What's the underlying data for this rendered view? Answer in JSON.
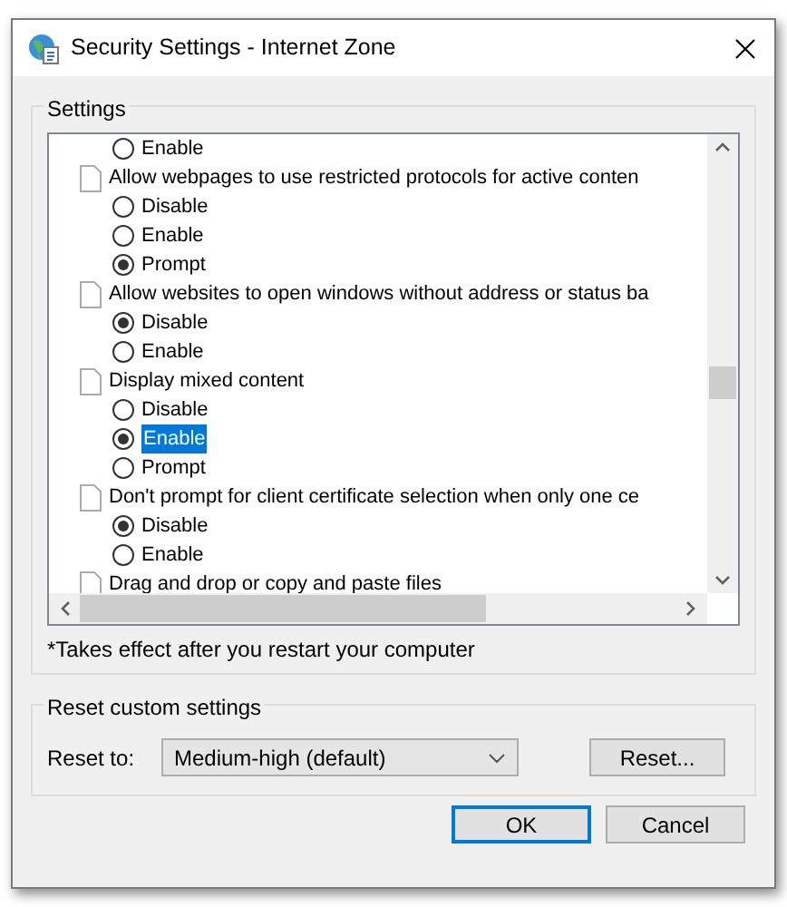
{
  "window": {
    "title": "Security Settings - Internet Zone"
  },
  "settings": {
    "title": "Settings",
    "items": [
      {
        "kind": "option",
        "label": "Enable",
        "selected": false,
        "highlighted": false
      },
      {
        "kind": "setting",
        "label": "Allow webpages to use restricted protocols for active conten",
        "children": [
          {
            "kind": "option",
            "label": "Disable",
            "selected": false,
            "highlighted": false
          },
          {
            "kind": "option",
            "label": "Enable",
            "selected": false,
            "highlighted": false
          },
          {
            "kind": "option",
            "label": "Prompt",
            "selected": true,
            "highlighted": false
          }
        ]
      },
      {
        "kind": "setting",
        "label": "Allow websites to open windows without address or status ba",
        "children": [
          {
            "kind": "option",
            "label": "Disable",
            "selected": true,
            "highlighted": false
          },
          {
            "kind": "option",
            "label": "Enable",
            "selected": false,
            "highlighted": false
          }
        ]
      },
      {
        "kind": "setting",
        "label": "Display mixed content",
        "children": [
          {
            "kind": "option",
            "label": "Disable",
            "selected": false,
            "highlighted": false
          },
          {
            "kind": "option",
            "label": "Enable",
            "selected": true,
            "highlighted": true
          },
          {
            "kind": "option",
            "label": "Prompt",
            "selected": false,
            "highlighted": false
          }
        ]
      },
      {
        "kind": "setting",
        "label": "Don't prompt for client certificate selection when only one ce",
        "children": [
          {
            "kind": "option",
            "label": "Disable",
            "selected": true,
            "highlighted": false
          },
          {
            "kind": "option",
            "label": "Enable",
            "selected": false,
            "highlighted": false
          }
        ]
      },
      {
        "kind": "setting",
        "label": "Drag and drop or copy and paste files"
      }
    ],
    "note": "*Takes effect after you restart your computer"
  },
  "reset": {
    "title": "Reset custom settings",
    "label": "Reset to:",
    "value": "Medium-high (default)",
    "button": "Reset..."
  },
  "buttons": [
    {
      "label": "OK",
      "default": true
    },
    {
      "label": "Cancel",
      "default": false
    }
  ]
}
